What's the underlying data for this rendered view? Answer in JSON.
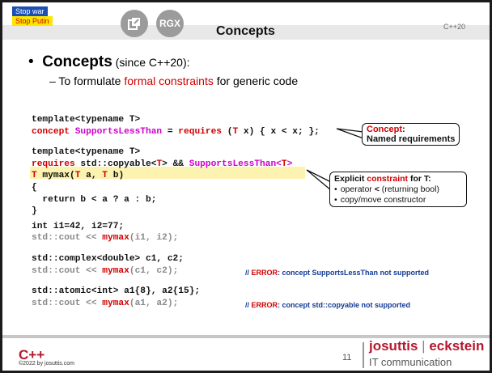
{
  "header": {
    "stop_war": "Stop war",
    "stop_putin": "Stop Putin",
    "icon_rgx": "RGX",
    "title": "Concepts",
    "version_tag": "C++20"
  },
  "bullets": {
    "main_bold": "Concepts",
    "main_rest": " (since C++20):",
    "sub_prefix": "–  To formulate ",
    "sub_highlight": "formal constraints",
    "sub_suffix": " for generic code"
  },
  "code": {
    "l1": "template<typename T>",
    "l2_kw": "concept",
    "l2_name": " SupportsLessThan",
    "l2_eq": " = ",
    "l2_req": "requires",
    "l2_a": " (",
    "l2_T": "T",
    "l2_b": " x) { x < x; };",
    "l3": "template<typename T>",
    "l4_req": "requires",
    "l4_mid": " std::copyable<",
    "l4_T": "T",
    "l4_and": "> && ",
    "l4_name": "SupportsLessThan<",
    "l4_T2": "T",
    "l4_end": ">",
    "l5_T": "T",
    "l5_mid": " mymax(",
    "l5_T2": "T",
    "l5_a": " a, ",
    "l5_T3": "T",
    "l5_b": " b)",
    "l6": "{",
    "l7": "  return b < a ? a : b;",
    "l8": "}",
    "l9": "int i1=42, i2=77;",
    "l10_a": "std::cout << ",
    "l10_fn": "mymax",
    "l10_b": "(i1, i2);",
    "l11": "std::complex<double> c1, c2;",
    "l12_a": "std::cout << ",
    "l12_fn": "mymax",
    "l12_b": "(c1, c2);",
    "l13": "std::atomic<int> a1{8}, a2{15};",
    "l14_a": "std::cout << ",
    "l14_fn": "mymax",
    "l14_b": "(a1, a2);"
  },
  "errors": {
    "e1_pre": "// ",
    "e1_kw": "ERROR",
    "e1_rest": ": concept SupportsLessThan not supported",
    "e2_pre": "// ",
    "e2_kw": "ERROR",
    "e2_rest": ": concept std::copyable not supported"
  },
  "callouts": {
    "concept_title": "Concept",
    "concept_colon": ":",
    "concept_desc": "Named requirements",
    "constraint_a": "Explicit ",
    "constraint_b": "constraint",
    "constraint_c": " for T:",
    "item1_a": "operator ",
    "item1_b": "<",
    "item1_c": " (returning bool)",
    "item2": "copy/move constructor"
  },
  "footer": {
    "cpp": "C++",
    "copyright": "©2022 by josuttis.com",
    "page": "11",
    "brand_a": "josuttis",
    "brand_sep": " | ",
    "brand_b": "eckstein",
    "brand_sub": "IT communication"
  },
  "colors": {
    "keyword_red": "#d00000",
    "concept_pink": "#cc00cc",
    "brand_red": "#b5172f",
    "error_blue": "#123a94",
    "highlight_yellow": "#fcf3b0"
  }
}
